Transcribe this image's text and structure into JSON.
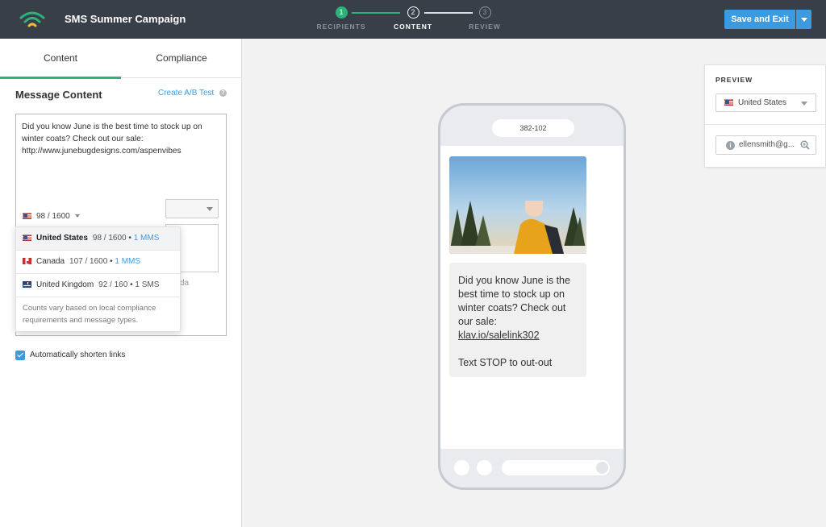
{
  "header": {
    "title": "SMS Summer Campaign",
    "steps": [
      {
        "num": "1",
        "label": "RECIPIENTS"
      },
      {
        "num": "2",
        "label": "CONTENT"
      },
      {
        "num": "3",
        "label": "REVIEW"
      }
    ],
    "save_label": "Save and Exit"
  },
  "tabs": {
    "content": "Content",
    "compliance": "Compliance"
  },
  "editor": {
    "section_title": "Message Content",
    "ab_test_link": "Create A/B Test",
    "help_glyph": "?",
    "message_lines": [
      "Did you know June is the best time to stock up on",
      "winter coats? Check out our sale:",
      "http://www.junebugdesigns.com/aspenvibes"
    ],
    "char_count": "98 / 1600",
    "hidden_text": "da",
    "shorten_links_label": "Automatically shorten links",
    "shorten_links_checked": true
  },
  "country_dropdown": {
    "items": [
      {
        "country": "United States",
        "count": "98 / 1600",
        "type": "1 MMS",
        "selected": true
      },
      {
        "country": "Canada",
        "count": "107 / 1600",
        "type": "1 MMS",
        "selected": false
      },
      {
        "country": "United Kingdom",
        "count": "92 / 160",
        "type": "1 SMS",
        "selected": false
      }
    ],
    "separator": "•",
    "note": "Counts vary based on local compliance requirements and message types."
  },
  "phone": {
    "sender": "382-102",
    "message_lines": [
      "Did you know June is the",
      "best time to stock up on",
      "winter coats? Check out",
      "our sale:"
    ],
    "link": "klav.io/salelink302",
    "stop_text": "Text STOP to out-out"
  },
  "preview": {
    "title": "PREVIEW",
    "country": "United States",
    "profile_email": "ellensmith@g..."
  },
  "colors": {
    "topbar": "#393f48",
    "accent_green": "#2db37a",
    "accent_blue": "#3c9ae0"
  }
}
